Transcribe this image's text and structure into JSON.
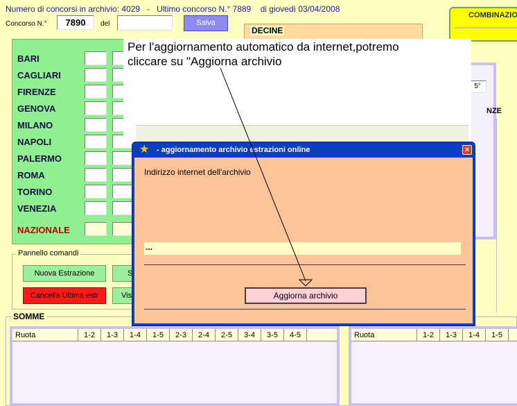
{
  "header": {
    "archivio_info": "Numero di concorsi in archivio: 4029   -   Ultimo concorso N.° 7889    di giovedì 03/04/2008",
    "concorso_label": "Concorso N.°",
    "concorso_value": "7890",
    "del_label": "del",
    "del_value": "",
    "salva_label": "Salva"
  },
  "combinazioni_title": "COMBINAZIO",
  "decine_title": "DECINE",
  "nze_label": "NZE",
  "stepper_value": "5°",
  "ruote": [
    "BARI",
    "CAGLIARI",
    "FIRENZE",
    "GENOVA",
    "MILANO",
    "NAPOLI",
    "PALERMO",
    "ROMA",
    "TORINO",
    "VENEZIA"
  ],
  "nazionale": "NAZIONALE",
  "pannello": {
    "title": "Pannello comandi",
    "nuova_estrazione": "Nuova Estrazione",
    "cancella_ultima": "Cancella Ultima estr",
    "s_label": "S",
    "vis_label": "Vis"
  },
  "somme": {
    "title": "SOMME",
    "columns": [
      "Ruota",
      "1-2",
      "1-3",
      "1-4",
      "1-5",
      "2-3",
      "2-4",
      "2-5",
      "3-4",
      "3-5",
      "4-5"
    ],
    "right_columns": [
      "Ruota",
      "1-2",
      "1-3",
      "1-4",
      "1-5"
    ]
  },
  "callout": {
    "line1": "Per l'aggiornamento automatico da internet,potremo",
    "line2": "cliccare su \"Aggiorna archivio"
  },
  "dialog": {
    "title": " - aggiornamento archivio estrazioni online",
    "indirizzo_label": "Indirizzo internet dell'archivio",
    "url_value": "...",
    "button_label": "Aggiorna archivio"
  },
  "colors": {
    "page_bg": "#ffffc0",
    "ruote_panel": "#8ff08f",
    "dialog_bg": "#fdc497",
    "title_bar": "#0a3fc0",
    "salva_button": "#8c8cf0",
    "combinazioni_bg": "#ffff00",
    "decine_bg": "#ffd9a0"
  }
}
